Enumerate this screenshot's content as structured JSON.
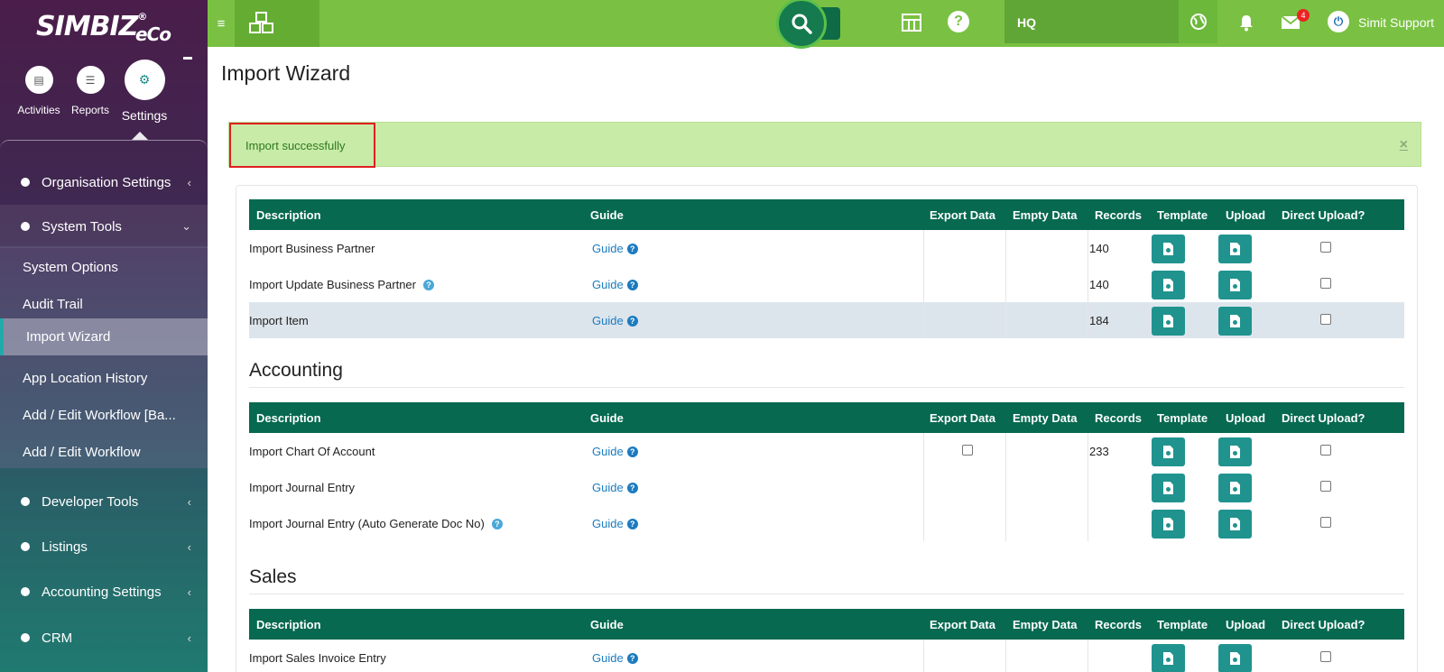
{
  "brand": {
    "logo": "SIMBIZ",
    "reg": "®",
    "eco": "eCo"
  },
  "modules": [
    {
      "label": "Activities",
      "icon": "document-icon"
    },
    {
      "label": "Reports",
      "icon": "report-icon"
    },
    {
      "label": "Settings",
      "icon": "gear-icon"
    }
  ],
  "sidebar": {
    "items": [
      {
        "label": "Organisation Settings"
      },
      {
        "label": "System Tools"
      },
      {
        "label": "Developer Tools"
      },
      {
        "label": "Listings"
      },
      {
        "label": "Accounting Settings"
      },
      {
        "label": "CRM"
      }
    ],
    "sub_items": [
      {
        "label": "System Options"
      },
      {
        "label": "Audit Trail"
      },
      {
        "label": "Import Wizard"
      },
      {
        "label": "App Location History"
      },
      {
        "label": "Add / Edit Workflow [Ba..."
      },
      {
        "label": "Add / Edit Workflow"
      }
    ]
  },
  "topbar": {
    "location": "HQ",
    "mail_badge": "4",
    "user": "Simit Support"
  },
  "page": {
    "title": "Import Wizard",
    "alert": "Import successfully",
    "close": "×"
  },
  "columns": [
    "Description",
    "Guide",
    "Export Data",
    "Empty Data",
    "Records",
    "Template",
    "Upload",
    "Direct Upload?"
  ],
  "guide_label": "Guide",
  "sections": [
    {
      "title": "",
      "rows": [
        {
          "description": "Import Business Partner",
          "info": false,
          "records": "140",
          "export_checkbox": false
        },
        {
          "description": "Import Update Business Partner",
          "info": true,
          "records": "140",
          "export_checkbox": false
        },
        {
          "description": "Import Item",
          "info": false,
          "records": "184",
          "export_checkbox": false,
          "highlighted": true
        }
      ]
    },
    {
      "title": "Accounting",
      "rows": [
        {
          "description": "Import Chart Of Account",
          "info": false,
          "records": "233",
          "export_checkbox": true
        },
        {
          "description": "Import Journal Entry",
          "info": false,
          "records": "",
          "export_checkbox": false
        },
        {
          "description": "Import Journal Entry (Auto Generate Doc No)",
          "info": true,
          "records": "",
          "export_checkbox": false
        }
      ]
    },
    {
      "title": "Sales",
      "rows": [
        {
          "description": "Import Sales Invoice Entry",
          "info": false,
          "records": "",
          "export_checkbox": false
        }
      ]
    }
  ]
}
